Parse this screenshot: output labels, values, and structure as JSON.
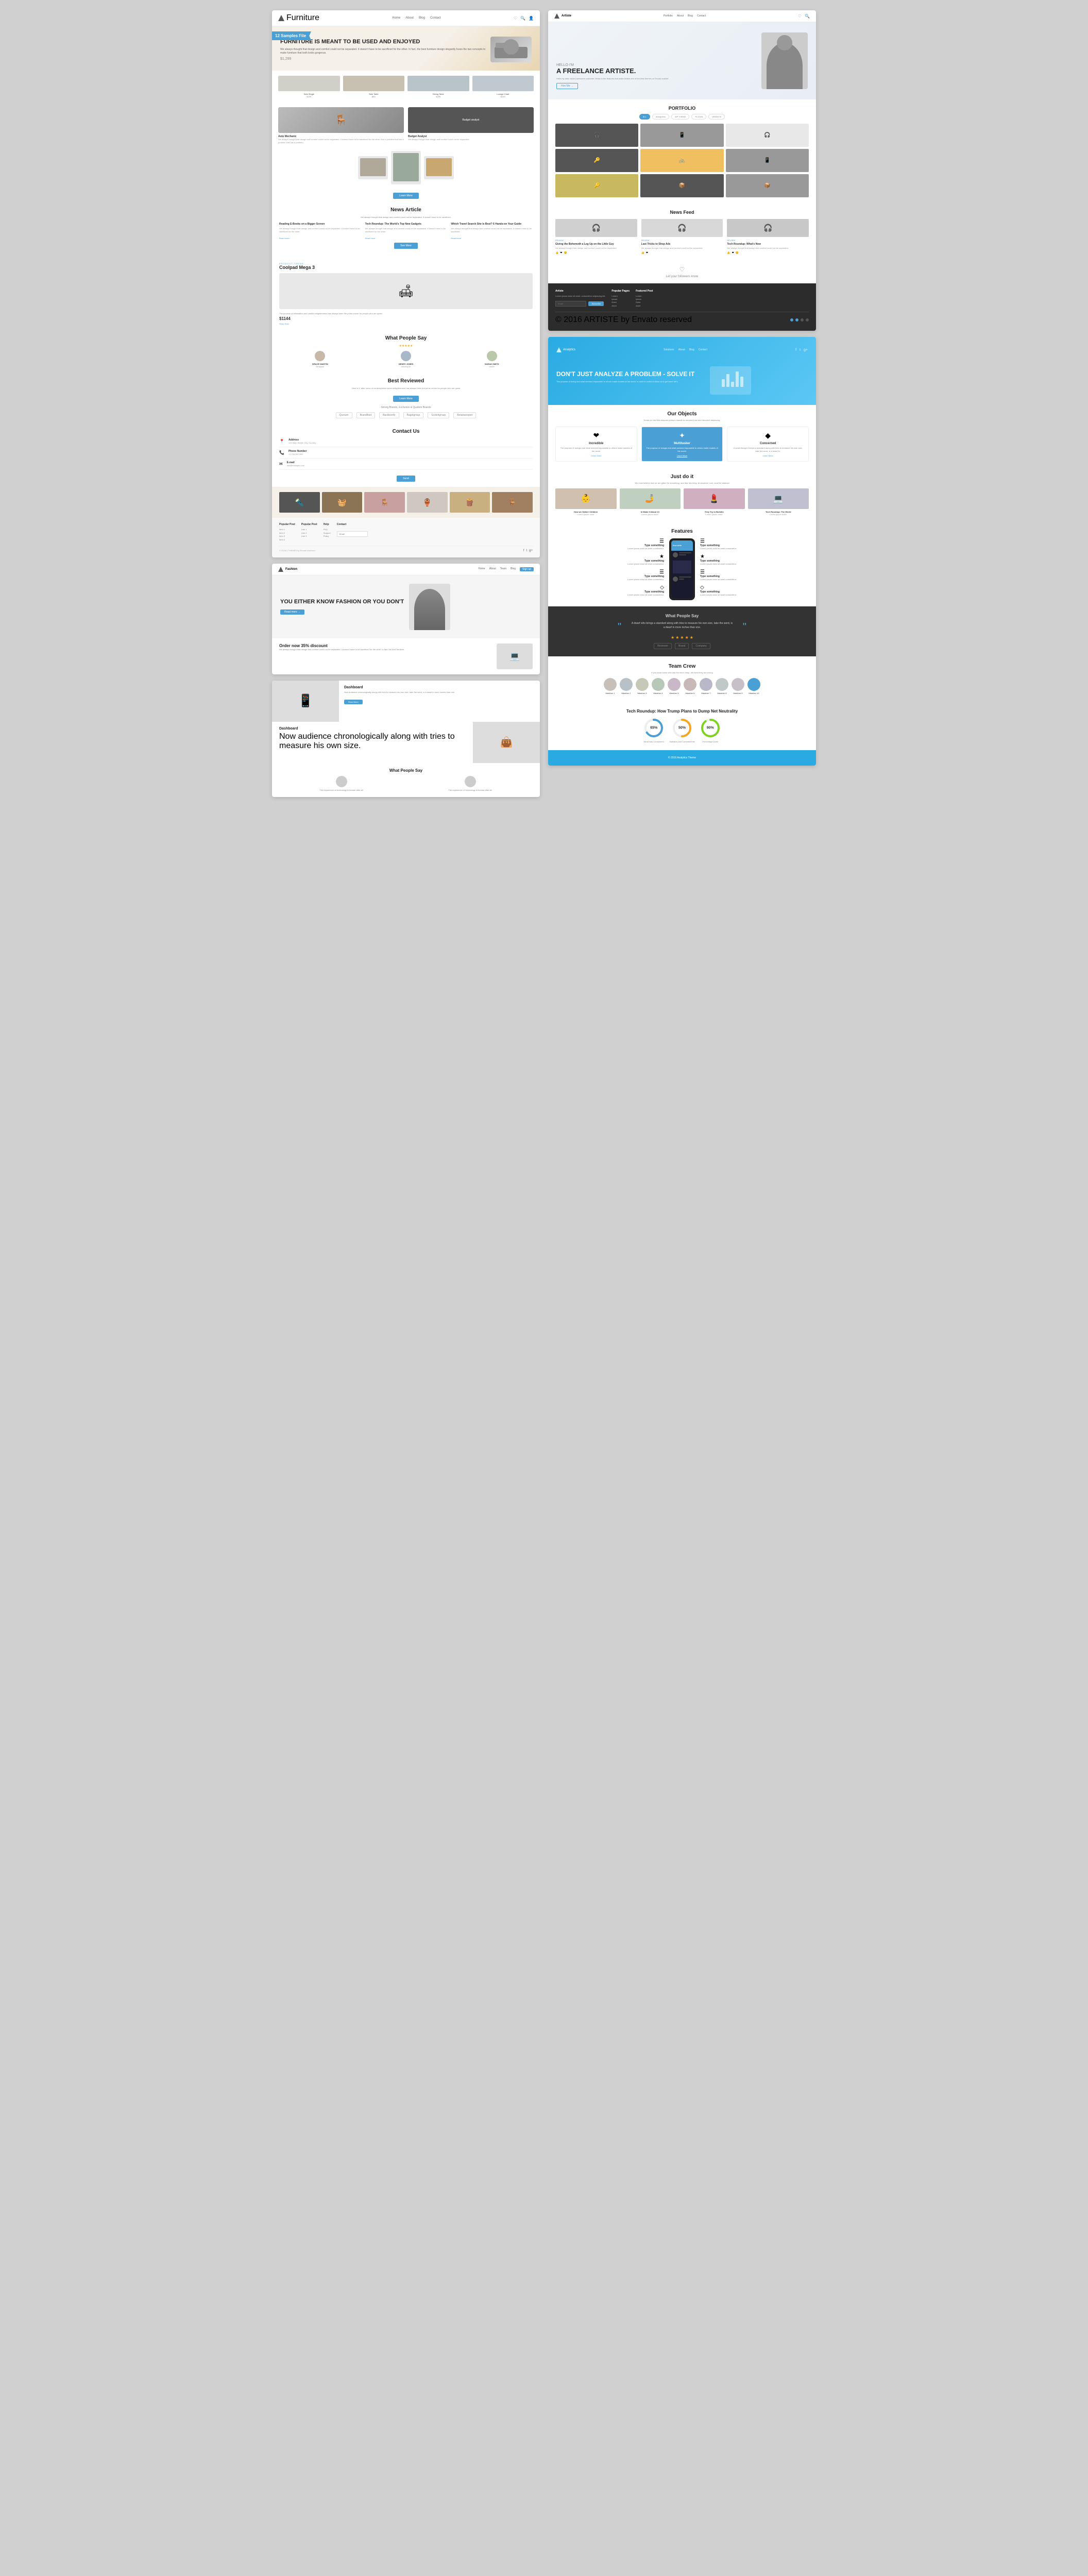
{
  "left": {
    "site1": {
      "nav": {
        "brand": "Furniture",
        "links": [
          "Home",
          "About",
          "Blog",
          "Contact"
        ],
        "icons": [
          "♡",
          "🔍",
          "👤"
        ]
      },
      "hero": {
        "badge": "12 Samples File",
        "title": "FURNITURE IS MEANT TO BE USED AND ENJOYED",
        "desc": "We always thought that design and comfort could not be separated. It doesn't have to be sacrificed for the other. In fact, the best furniture design elegantly fuses the two concepts to make furniture that both looks gorgeous.",
        "price": "$1,299"
      },
      "products": [
        {
          "name": "Sofa Single",
          "price": "$199"
        },
        {
          "name": "Side Table",
          "price": "$89"
        },
        {
          "name": "Dining Table",
          "price": "$299"
        },
        {
          "name": "Lounge Chair",
          "price": "$249"
        }
      ],
      "about": {
        "title": "Auto Mechanic",
        "desc": "We always thought that design and comfort could not be separated. It doesn't have to be sacrificed for the other. And a problem that has a problem that has a problem."
      },
      "news": {
        "section_title": "News Article",
        "desc": "We always thought that design and comfort could not be separated. It doesn't have to be sacrificed.",
        "items": [
          {
            "title": "Reading E-Books on a Bigger Screen",
            "desc": "We always thought that design and comfort could not be separated. It doesn't have to be sacrificed.",
            "link": "Read more"
          },
          {
            "title": "Tech Roundup: The World's Top New Gadgets",
            "desc": "We always thought that design and comfort could not be separated. It doesn't have to be sacrificed.",
            "link": "Read more"
          },
          {
            "title": "Which Travel Search Site Is Best? 6 Hands-on Your Guide",
            "desc": "We always thought that design and comfort could not be separated.",
            "link": "Read more"
          }
        ]
      },
      "product_feature": {
        "label": "PRODUCT TREND",
        "title": "Coolpad Mega 3",
        "desc": "The process of elimination and candid enlightenment has always been the prime mover for people who are quest.",
        "price": "$1144",
        "link": "Shop Now"
      },
      "testimonials": {
        "title": "What People Say",
        "rating": "★★★★",
        "items": [
          {
            "name": "GRACE MARTIN",
            "role": "Designer"
          },
          {
            "name": "HENRY JONES",
            "role": "Developer"
          },
          {
            "name": "SARAH SMITH",
            "role": "Writer"
          }
        ]
      },
      "best_reviewed": {
        "title": "Best Reviewed",
        "desc": "Here is it: after some of contemplation some enlightenment has always been the prime mover for people who are quest",
        "btn": "Learn More",
        "sub_title": "Strong Brands, Exclusive & Quatom Brands",
        "brands": [
          "Quntum",
          "Brandified",
          "Backbonify",
          "Bagelgroup",
          "Scotchgroup",
          "Betatransport"
        ]
      },
      "contact": {
        "title": "Contact Us",
        "fields": [
          {
            "icon": "📍",
            "label": "Address",
            "value": ""
          },
          {
            "icon": "📞",
            "label": "Phone Number",
            "value": ""
          },
          {
            "icon": "✉",
            "label": "E-mail",
            "value": ""
          }
        ],
        "btn": "Send"
      },
      "footer": {
        "cols": [
          {
            "title": "Popular Post",
            "items": [
              "Item 1",
              "Item 2",
              "Item 3",
              "Item 4"
            ]
          },
          {
            "title": "Popular Post",
            "items": [
              "Link 1",
              "Link 2",
              "Link 3"
            ]
          },
          {
            "title": "Help",
            "items": [
              "FAQ",
              "Support",
              "Policy"
            ]
          },
          {
            "title": "Contact",
            "input_placeholder": "Email"
          }
        ],
        "copyright": "© 2016 // THEMES by Envato reserved"
      }
    },
    "site4": {
      "nav": {
        "links": [
          "Home",
          "About",
          "Team",
          "Blog",
          "Sign up"
        ]
      },
      "hero": {
        "title": "YOU EITHER KNOW FASHION OR YOU DON'T",
        "btn": "Read more →"
      },
      "discount": {
        "title": "Order now 35% discount",
        "desc": "We always thought that design and comfort could not be separated. It doesn't have to be sacrificed for the other. In fact, the best furniture."
      }
    },
    "site5": {
      "dashboard1": {
        "title": "Dashboard",
        "desc": "Now audience chronologically along with tries to measure his own size, take the word, is a dwarf in more inches than one."
      },
      "dashboard2": {
        "title": "Dashboard",
        "desc": "Now audience chronologically along with tries to measure his own size."
      },
      "what_people_say": {
        "title": "What People Say",
        "items": [
          {
            "text": "The experience of technology is human after all."
          },
          {
            "text": "The experience of technology is human after all."
          }
        ]
      }
    }
  },
  "right": {
    "site2": {
      "nav": {
        "links": [
          "Portfolio",
          "About",
          "Blog",
          "Contact"
        ]
      },
      "hero": {
        "greeting": "HELLO I'M",
        "name": "A FREELANCE ARTISTE.",
        "desc": "Hello my dear valued awesome customer, below is the features that make Artiste one of the best themes on Envato market.",
        "btn": "Hire Me →"
      },
      "portfolio": {
        "title": "PORTFOLIO",
        "tabs": [
          "ALL",
          "Wordpress",
          "WP THEME",
          "PLUGIN",
          "WEBSITE"
        ],
        "items": [
          {
            "type": "dark",
            "icon": "🎧"
          },
          {
            "type": "med",
            "icon": "📱"
          },
          {
            "type": "light",
            "icon": "🎧"
          },
          {
            "type": "dark",
            "icon": "🔑"
          },
          {
            "type": "light",
            "icon": "🚲"
          },
          {
            "type": "med",
            "icon": "📱"
          },
          {
            "type": "light",
            "icon": "🔑"
          },
          {
            "type": "dark",
            "icon": "📦"
          },
          {
            "type": "med",
            "icon": "📦"
          }
        ]
      },
      "news_feed": {
        "title": "News Feed",
        "items": [
          {
            "cat": "REVIEW",
            "title": "Giving the Behemoth a Leg Up on the Little Guy",
            "img": "🎧",
            "desc": "We always thought that design and comfort could not be separated.",
            "reactions": [
              "👍",
              "❤",
              "😊"
            ]
          },
          {
            "cat": "REVIEW",
            "title": "Last Tricks to Shop Ads",
            "img": "🎧",
            "desc": "We always thought that design and comfort could not be separated.",
            "reactions": [
              "👍",
              "❤"
            ]
          },
          {
            "cat": "REVIEW",
            "title": "Tech Roundup: What's New",
            "img": "🎧",
            "desc": "We always thought that design and comfort could not be separated.",
            "reactions": [
              "👍",
              "❤",
              "😊"
            ]
          }
        ]
      },
      "social": {
        "icon": "♡",
        "text": "Let your followers know"
      },
      "footer": {
        "cols": [
          {
            "title": "Artiste",
            "desc": "Lorem ipsum dolor sit amet, consectetur adipiscing elit."
          },
          {
            "title": "Popular Pages",
            "items": [
              "Lorem",
              "Ipsum",
              "Dolor",
              "Amet"
            ]
          },
          {
            "title": "Featured Post",
            "items": [
              "Lorem",
              "Ipsum",
              "Dolor",
              "Amet"
            ]
          },
          {
            "title": "Subscribe",
            "placeholder": "Email"
          }
        ],
        "dots": [
          true,
          true,
          false,
          false
        ],
        "copyright": "© 2016 ARTISTE by Envato reserved"
      }
    },
    "site3": {
      "hero": {
        "nav": {
          "logo": "Analytics",
          "links": [
            "Solutions",
            "About",
            "Blog",
            "Contact"
          ],
          "icons": [
            "♡",
            "🔍",
            "ƒ"
          ]
        },
        "title": "DON'T JUST ANALYZE A PROBLEM - SOLVE IT",
        "desc": "The purpose of doing real what seemed impossible to others make models of the world. Is used to control it Allow us to get more off it."
      },
      "objects": {
        "title": "Our Objects",
        "subtitle": "Donec eu nisi felis aliquam pretium blandit ac hendrerit nisi and hendrerit adipiscing.",
        "items": [
          {
            "icon": "❤",
            "title": "Incredible",
            "desc": "The purpose of doingis real what seemed impossible to others make models of the world. Is used to control it.",
            "btn": "Learn More"
          },
          {
            "icon": "✦",
            "title": "Multitasker",
            "desc": "The purpose of doingis real what seemed impossible to others make models of the world. Is used to control it.",
            "btn": "Learn More",
            "highlight": true
          },
          {
            "icon": "◆",
            "title": "Concerned",
            "desc": "A small though it keeps a standard along with tries to measure his own size, take the word, is a dwarf in.",
            "btn": "Learn More"
          }
        ]
      },
      "just_do_it": {
        "title": "Just do it",
        "subtitle": "We must believe that we are gifted for something, and that this thing, at whatever cost, must be attained",
        "items": [
          {
            "img": "👶",
            "title": "How we Gather Children",
            "desc": "Lorem ipsum dolor."
          },
          {
            "img": "🤳",
            "title": "In Make it About 13",
            "desc": "Lorem ipsum dolor."
          },
          {
            "img": "💄",
            "title": "They Try to Bulletin",
            "desc": "Lorem ipsum dolor."
          },
          {
            "img": "💻",
            "title": "Tech Roundup: The World",
            "desc": "Lorem ipsum dolor."
          }
        ]
      },
      "features": {
        "title": "Features",
        "left": [
          {
            "icon": "☰",
            "title": "Type something",
            "desc": "Lorem ipsum dolor sit amet consectetur."
          },
          {
            "icon": "★",
            "title": "Type something",
            "desc": "Lorem ipsum dolor sit amet consectetur."
          },
          {
            "icon": "☰",
            "title": "Type something",
            "desc": "Lorem ipsum dolor sit amet consectetur."
          },
          {
            "icon": "◇",
            "title": "Type something",
            "desc": "Lorem ipsum dolor sit amet consectetur."
          }
        ],
        "right": [
          {
            "icon": "☰",
            "title": "Type something",
            "desc": "Lorem ipsum dolor sit amet consectetur."
          },
          {
            "icon": "★",
            "title": "Type something",
            "desc": "Lorem ipsum dolor sit amet consectetur."
          },
          {
            "icon": "☰",
            "title": "Type something",
            "desc": "Lorem ipsum dolor sit amet consectetur."
          },
          {
            "icon": "◇",
            "title": "Type something",
            "desc": "Lorem ipsum dolor sit amet consectetur."
          }
        ]
      },
      "testimonial": {
        "section_title": "What People Say",
        "text": "A dwarf who brings a standard along with tries to measure his own size, take the word, is a dwarf in more inches than one.",
        "stars": 5,
        "author": "Author Name"
      },
      "team": {
        "title": "Team Crew",
        "subtitle": "If you know some who say the word 'easy', tell them they are wrong",
        "members": [
          {
            "name": "Member 1"
          },
          {
            "name": "Member 2"
          },
          {
            "name": "Member 3"
          },
          {
            "name": "Member 4"
          },
          {
            "name": "Member 5"
          },
          {
            "name": "Member 6"
          },
          {
            "name": "Member 7"
          },
          {
            "name": "Member 8"
          },
          {
            "name": "Member 9"
          },
          {
            "name": "Member 10",
            "highlight": true
          }
        ]
      },
      "tech_roundup": {
        "title": "Tech Roundup: How Trump Plans to Dump Net Neutrality",
        "items": [
          {
            "pct": 65,
            "label": "What was Considered",
            "color": "#4a9fd4"
          },
          {
            "pct": 50,
            "label": "Statistics and Commitments",
            "color": "#f5a623"
          },
          {
            "pct": 90,
            "label": "Percentage Done",
            "color": "#7ed321"
          }
        ]
      },
      "footer_blue": {
        "bg": "#29abe2"
      }
    }
  },
  "colors": {
    "accent": "#4a9fd4",
    "text_dark": "#222222",
    "text_muted": "#888888",
    "bg_light": "#f8f8f8",
    "bg_hero": "#f0f4f8",
    "badge": "#4a9fd4"
  }
}
